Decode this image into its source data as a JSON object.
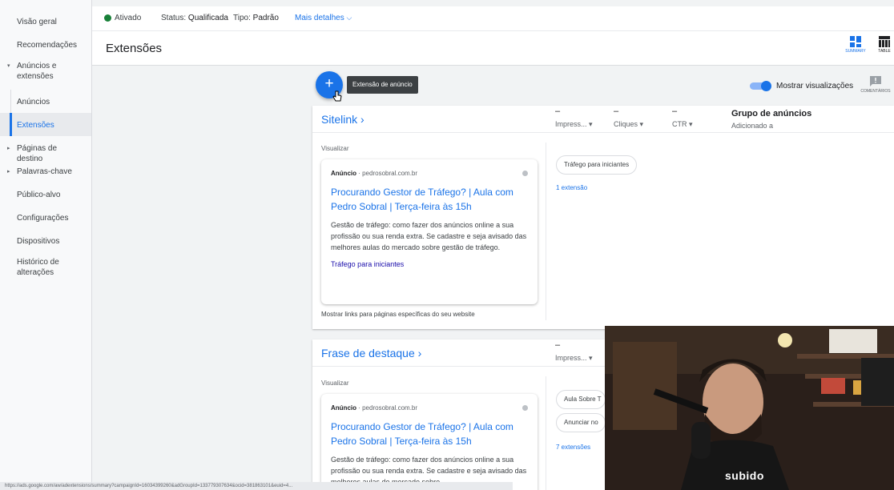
{
  "sidebar": {
    "items": [
      {
        "label": "Visão geral"
      },
      {
        "label": "Recomendações"
      },
      {
        "label": "Anúncios e extensões"
      },
      {
        "label": "Anúncios"
      },
      {
        "label": "Extensões"
      },
      {
        "label": "Páginas de destino"
      },
      {
        "label": "Palavras-chave"
      },
      {
        "label": "Público-alvo"
      },
      {
        "label": "Configurações"
      },
      {
        "label": "Dispositivos"
      },
      {
        "label": "Histórico de alterações"
      }
    ]
  },
  "statusbar": {
    "state": "Ativado",
    "status_label": "Status:",
    "status_value": "Qualificada",
    "type_label": "Tipo:",
    "type_value": "Padrão",
    "details": "Mais detalhes"
  },
  "header": {
    "title": "Extensões",
    "summary": "SUMMARY",
    "table": "TABLE"
  },
  "toolbar": {
    "add_tooltip": "Extensão de anúncio",
    "toggle_label": "Mostrar visualizações",
    "comments": "COMENTÁRIOS"
  },
  "cards": [
    {
      "title": "Sitelink",
      "metrics": [
        {
          "value": "–",
          "label": "Impress..."
        },
        {
          "value": "–",
          "label": "Cliques"
        },
        {
          "value": "–",
          "label": "CTR"
        }
      ],
      "group_title": "Grupo de anúncios",
      "group_sub": "Adicionado a",
      "vis_label": "Visualizar",
      "ad": {
        "tag": "Anúncio",
        "domain": "pedrosobral.com.br",
        "title": "Procurando Gestor de Tráfego? | Aula com Pedro Sobral | Terça-feira às 15h",
        "desc": "Gestão de tráfego: como fazer dos anúncios online a sua profissão ou sua renda extra. Se cadastre e seja avisado das melhores aulas do mercado sobre gestão de tráfego.",
        "link": "Tráfego para iniciantes"
      },
      "footnote": "Mostrar links para páginas específicas do seu website",
      "chips": [
        "Tráfego para iniciantes"
      ],
      "ext_count": "1 extensão"
    },
    {
      "title": "Frase de destaque",
      "metrics": [
        {
          "value": "–",
          "label": "Impress..."
        }
      ],
      "vis_label": "Visualizar",
      "ad": {
        "tag": "Anúncio",
        "domain": "pedrosobral.com.br",
        "title": "Procurando Gestor de Tráfego? | Aula com Pedro Sobral | Terça-feira às 15h",
        "desc": "Gestão de tráfego: como fazer dos anúncios online a sua profissão ou sua renda extra. Se cadastre e seja avisado das melhores aulas do mercado sobre"
      },
      "chips": [
        "Aula Sobre T",
        "Anunciar no"
      ],
      "ext_count": "7 extensões"
    }
  ],
  "url_status": "https://ads.google.com/aw/adextensions/summary?campaignId=16034399260&adGroupId=133779307634&ocid=381863101&euid=4...",
  "webcam": {
    "shirt_text": "subido"
  },
  "colors": {
    "accent": "#1a73e8",
    "active_dot": "#188038"
  }
}
